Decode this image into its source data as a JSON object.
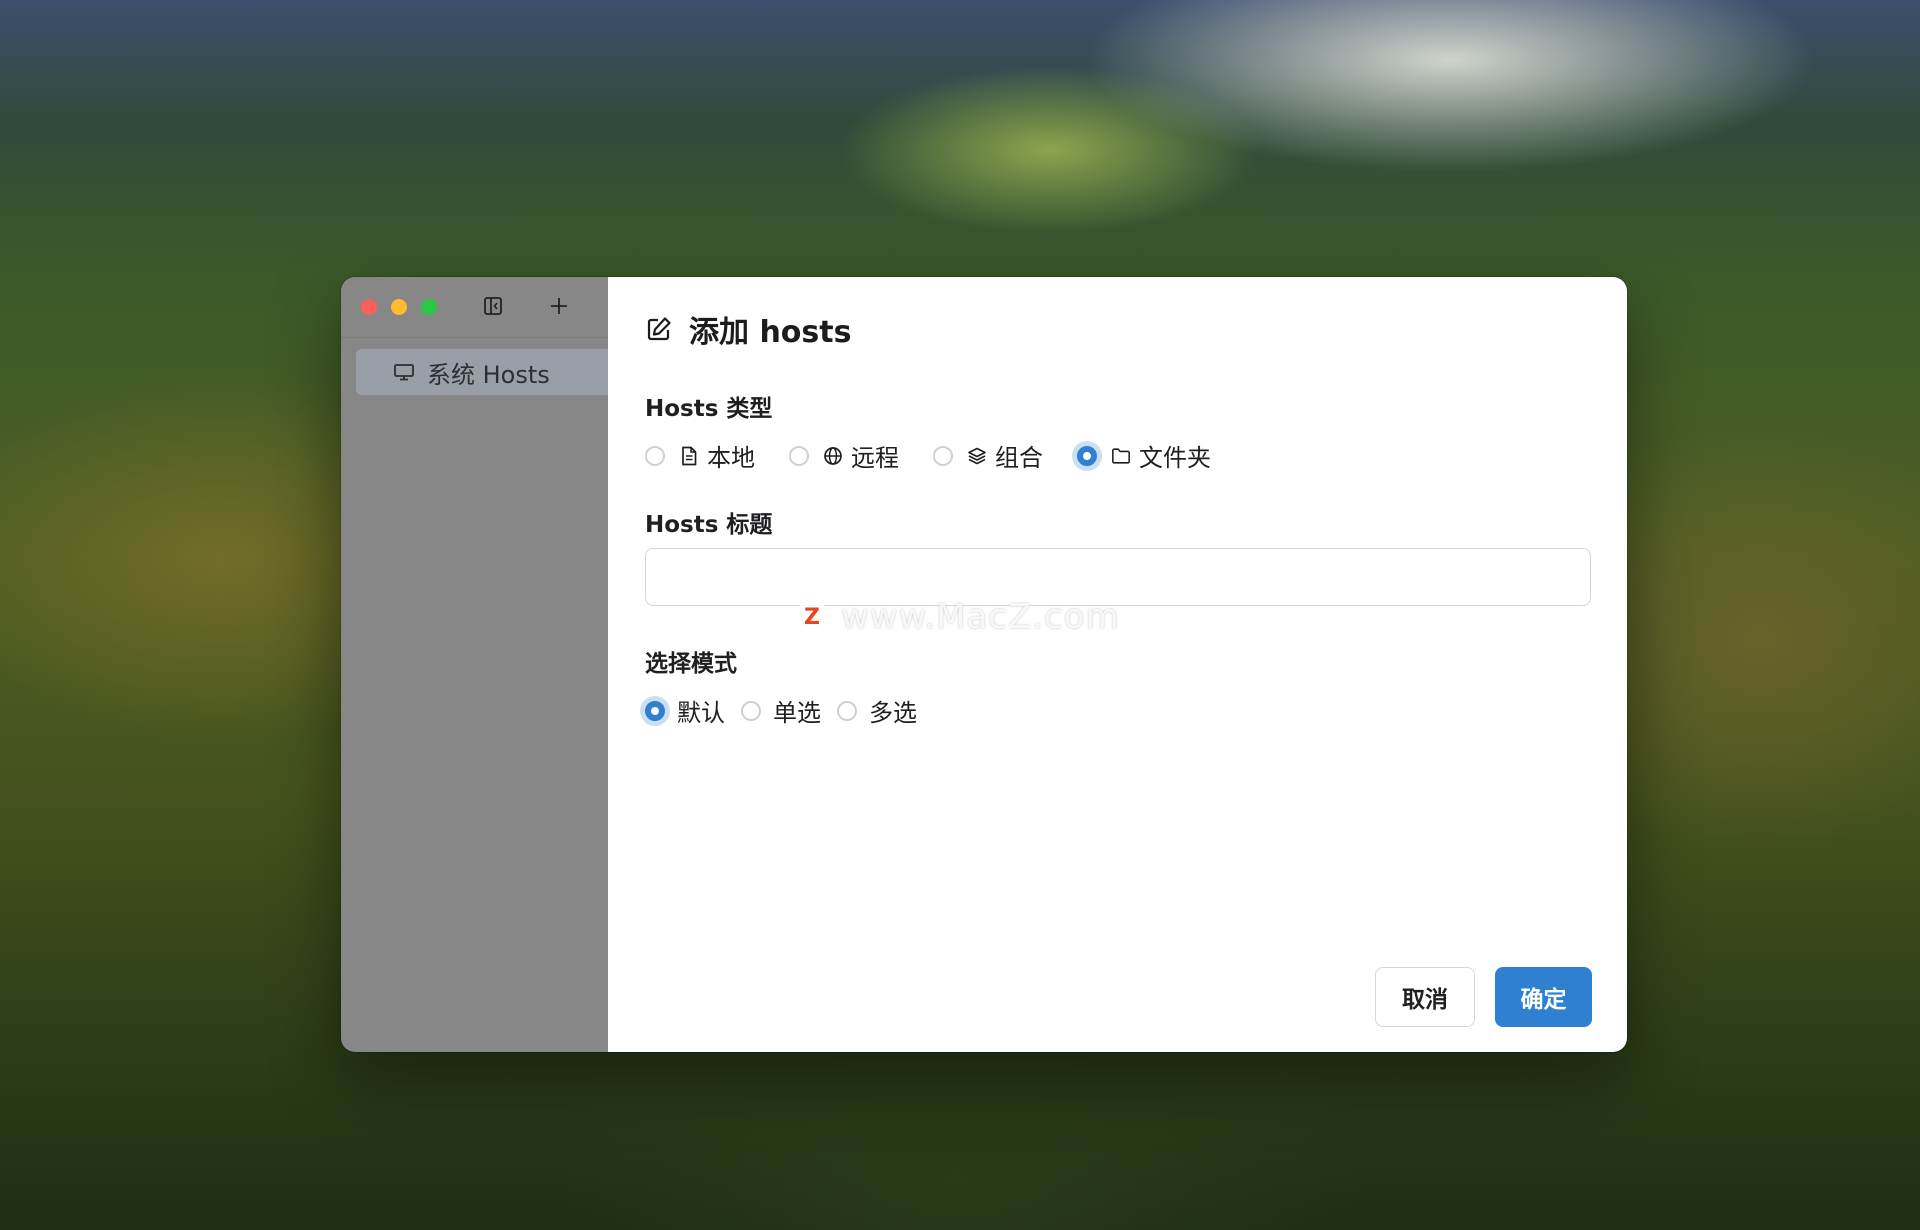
{
  "window": {
    "sidebar": {
      "items": [
        {
          "label": "系统 Hosts",
          "icon": "monitor-icon"
        }
      ]
    },
    "dialog": {
      "title": "添加 hosts",
      "title_icon": "edit-icon",
      "hosts_type": {
        "label": "Hosts 类型",
        "options": [
          {
            "label": "本地",
            "icon": "file-icon",
            "selected": false
          },
          {
            "label": "远程",
            "icon": "globe-icon",
            "selected": false
          },
          {
            "label": "组合",
            "icon": "layers-icon",
            "selected": false
          },
          {
            "label": "文件夹",
            "icon": "folder-icon",
            "selected": true
          }
        ]
      },
      "hosts_title": {
        "label": "Hosts 标题",
        "value": "",
        "placeholder": ""
      },
      "select_mode": {
        "label": "选择模式",
        "options": [
          {
            "label": "默认",
            "selected": true
          },
          {
            "label": "单选",
            "selected": false
          },
          {
            "label": "多选",
            "selected": false
          }
        ]
      },
      "buttons": {
        "cancel": "取消",
        "ok": "确定"
      }
    }
  },
  "watermark": {
    "logo": "Z",
    "text": "www.MacZ.com"
  },
  "colors": {
    "accent": "#2f80d1",
    "sidebar_bg": "#878787",
    "close": "#fe5f57",
    "minimize": "#febc2e",
    "maximize": "#28c840"
  }
}
